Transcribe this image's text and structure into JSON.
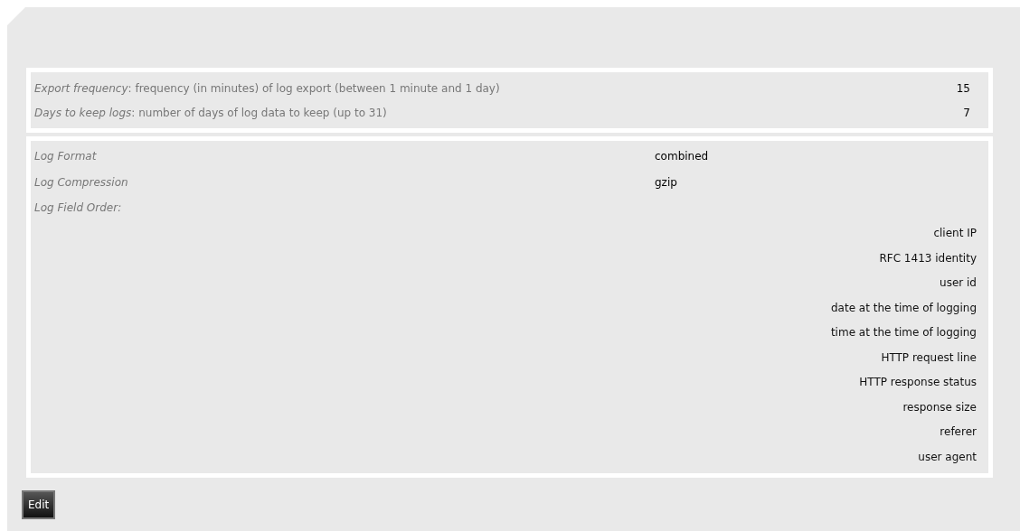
{
  "export_settings": [
    {
      "description": "*Export frequency*: frequency (in minutes) of log export (between 1 minute and 1 day)",
      "value": "15"
    },
    {
      "description": "*Days to keep logs*: number of days of log data to keep (up to 31)",
      "value": "7"
    }
  ],
  "log_settings": [
    {
      "label": "Log Format",
      "value": "combined"
    },
    {
      "label": "Log Compression",
      "value": "gzip"
    }
  ],
  "field_order": {
    "label": "Log Field Order:",
    "fields": [
      "client IP",
      "RFC 1413 identity",
      "user id",
      "date at the time of logging",
      "time at the time of logging",
      "HTTP request line",
      "HTTP response status",
      "response size",
      "referer",
      "user agent"
    ]
  },
  "buttons": [
    {
      "label": "Edit"
    }
  ]
}
